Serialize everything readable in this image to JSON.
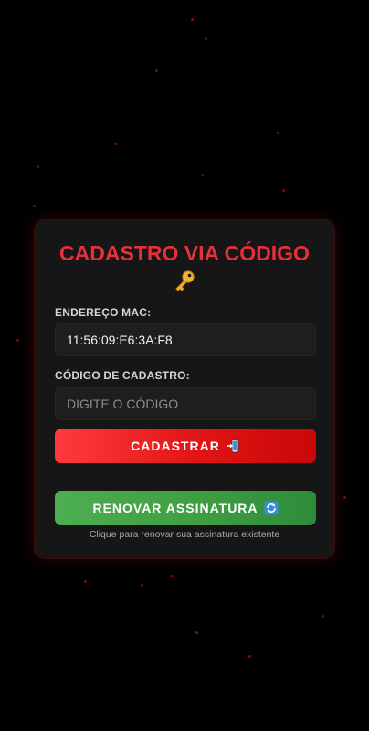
{
  "form": {
    "title": "CADASTRO VIA CÓDIGO",
    "title_icon": "key-icon",
    "mac_label": "ENDEREÇO MAC:",
    "mac_value": "11:56:09:E6:3A:F8",
    "code_label": "CÓDIGO DE CADASTRO:",
    "code_placeholder": "DIGITE O CÓDIGO",
    "code_value": "",
    "register_button": "CADASTRAR",
    "register_icon": "phone-arrow-icon",
    "renew_button": "RENOVAR ASSINATURA",
    "renew_icon": "refresh-icon",
    "renew_hint": "Clique para renovar sua assinatura existente"
  },
  "colors": {
    "accent": "#e8303a",
    "background": "#000000",
    "card": "#161616",
    "register_button": "#e11414",
    "renew_button": "#3f9e42"
  }
}
